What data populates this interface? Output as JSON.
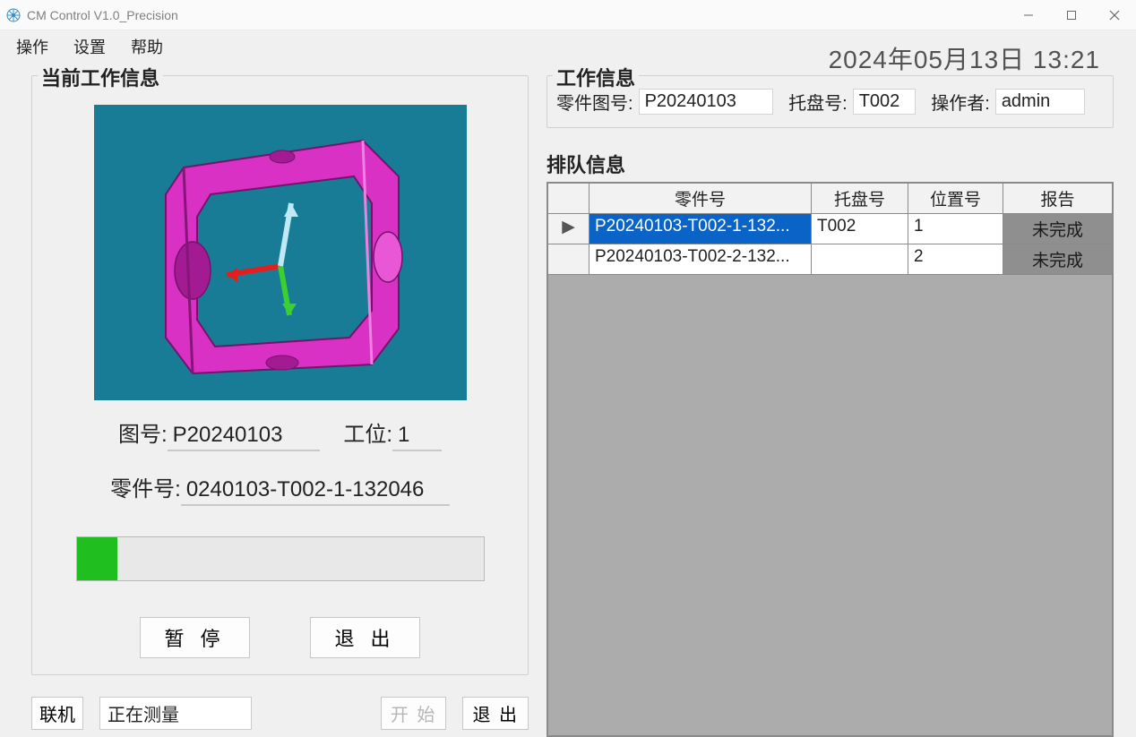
{
  "window": {
    "title": "CM Control V1.0_Precision"
  },
  "menu": {
    "op": "操作",
    "settings": "设置",
    "help": "帮助"
  },
  "datetime": "2024年05月13日 13:21",
  "left": {
    "legend": "当前工作信息",
    "label_drawing_no": "图号:",
    "drawing_no": "P20240103",
    "label_station": "工位:",
    "station": "1",
    "label_part_no": "零件号:",
    "part_no": "0240103-T002-1-132046",
    "progress_percent": 10,
    "btn_pause": "暂 停",
    "btn_exit": "退 出"
  },
  "bottom": {
    "btn_connect": "联机",
    "status": "正在测量",
    "btn_start": "开 始",
    "btn_exit": "退 出"
  },
  "right": {
    "legend": "工作信息",
    "label_part_drawing": "零件图号:",
    "part_drawing": "P20240103",
    "label_tray": "托盘号:",
    "tray": "T002",
    "label_operator": "操作者:",
    "operator": "admin"
  },
  "queue": {
    "legend": "排队信息",
    "headers": {
      "part": "零件号",
      "tray": "托盘号",
      "pos": "位置号",
      "report": "报告"
    },
    "rows": [
      {
        "marker": "▶",
        "part": "P20240103-T002-1-132...",
        "tray": "T002",
        "pos": "1",
        "report": "未完成",
        "selected": true
      },
      {
        "marker": "",
        "part": "P20240103-T002-2-132...",
        "tray": "",
        "pos": "2",
        "report": "未完成",
        "selected": false
      }
    ]
  }
}
